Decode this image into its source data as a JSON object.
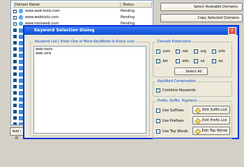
{
  "list": {
    "headers": {
      "domain": "Domain Name",
      "status": "Status"
    },
    "rows": [
      {
        "domain": "www.web-tools.com",
        "status": "Pending"
      },
      {
        "domain": "www.webtools.com",
        "status": "Pending"
      },
      {
        "domain": "www.toolsweb.com",
        "status": "Pending"
      }
    ]
  },
  "side_buttons": {
    "select_available": "Select Available Domains",
    "copy_selected": "Copy Selected Domains",
    "add_del": "Add / D"
  },
  "dialog": {
    "title": "Keyword Selection Dialog",
    "close": "x",
    "keyword_list": {
      "legend": "Keyword List [ Enter One or More KeyWords in Every Line",
      "value": "web-tools\nweb utils"
    },
    "extensions": {
      "legend": "Domain Extensions",
      "items": [
        {
          "label": ".com",
          "checked": true
        },
        {
          "label": ".net",
          "checked": true
        },
        {
          "label": ".org",
          "checked": true
        },
        {
          "label": ".info",
          "checked": true
        },
        {
          "label": ".biz",
          "checked": true
        },
        {
          "label": ".edu",
          "checked": true
        },
        {
          "label": ".ca",
          "checked": true
        },
        {
          "label": ".eu",
          "checked": true
        }
      ],
      "select_all": "Select All"
    },
    "combination": {
      "legend": "KeyWord Combination",
      "combine": "Combine Keywords",
      "combine_checked": true
    },
    "prefix": {
      "legend": "Prefix, Suffix, Hyphens",
      "use_suffixes": "Use Suffixes",
      "use_prefixes": "Use Prefixes",
      "use_top_words": "Use Top Words",
      "edit_suffix": "Edit Suffix List",
      "edit_prefix": "Edit Prefix List",
      "edit_top": "Edit Top Words"
    }
  }
}
